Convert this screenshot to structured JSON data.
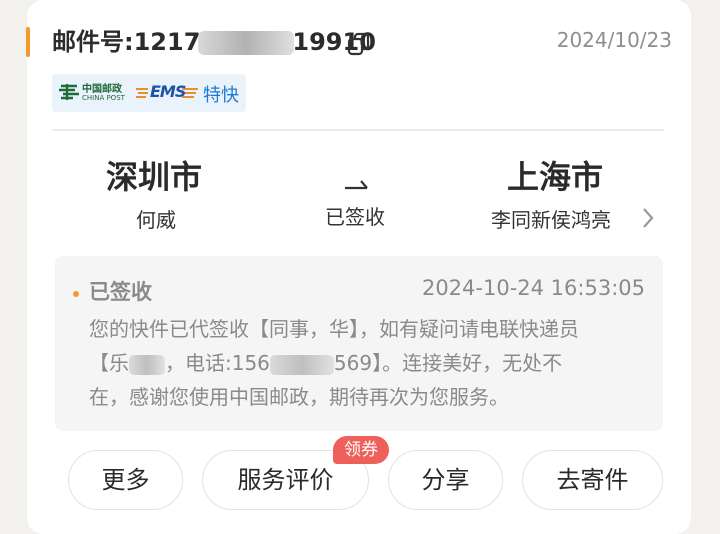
{
  "header": {
    "mail_prefix": "邮件号:1217",
    "mail_suffix": "19910",
    "date": "2024/10/23"
  },
  "carrier": {
    "china_post_cn": "中国邮政",
    "china_post_en": "CHINA POST",
    "ems": "EMS",
    "service": "特快"
  },
  "route": {
    "from_city": "深圳市",
    "from_person": "何威",
    "to_city": "上海市",
    "to_person": "李同新侯鸿亮",
    "status": "已签收"
  },
  "tracking": {
    "status": "已签收",
    "time": "2024-10-24 16:53:05",
    "line1": "您的快件已代签收【同事，华】，如有疑问请电联快递员",
    "line2_a": "【乐",
    "line2_b": "，电话:156",
    "line2_c": "569】。连接美好，无处不",
    "line3": "在，感谢您使用中国邮政，期待再次为您服务。"
  },
  "actions": {
    "more": "更多",
    "rate": "服务评价",
    "share": "分享",
    "send": "去寄件",
    "coupon": "领券"
  },
  "colors": {
    "accent": "#f29a2e",
    "badge": "#f0605a",
    "brand_blue": "#1c7ad6"
  }
}
